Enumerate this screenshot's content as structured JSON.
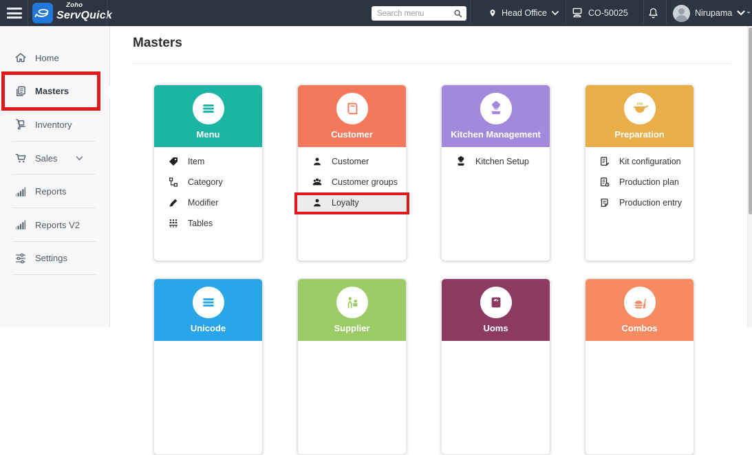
{
  "topbar": {
    "brand": {
      "zoho": "Zoho",
      "product": "ServQuick",
      "logo_color": "#2077d8"
    },
    "search": {
      "placeholder": "Search menu",
      "icon": "search-icon"
    },
    "location": {
      "label": "Head Office",
      "icon": "location-pin-icon"
    },
    "terminal": {
      "label": "CO-50025",
      "icon": "pos-terminal-icon"
    },
    "notifications": {
      "icon": "bell-icon"
    },
    "user": {
      "name": "Nirupama",
      "icon": "avatar"
    },
    "bar_color": "#2c3541"
  },
  "sidebar": {
    "items": [
      {
        "label": "Home",
        "icon": "home-icon"
      },
      {
        "label": "Masters",
        "icon": "masters-icon",
        "active": true,
        "annotated": true
      },
      {
        "label": "Inventory",
        "icon": "inventory-icon"
      },
      {
        "label": "Sales",
        "icon": "sales-cart-icon",
        "expandable": true
      },
      {
        "label": "Reports",
        "icon": "reports-icon"
      },
      {
        "label": "Reports V2",
        "icon": "reports-icon"
      },
      {
        "label": "Settings",
        "icon": "settings-sliders-icon"
      }
    ]
  },
  "main": {
    "title": "Masters",
    "cards": [
      {
        "title": "Menu",
        "color": "#1cb5a3",
        "icon": "menu-lines-icon",
        "items": [
          {
            "label": "Item",
            "icon": "tag-icon"
          },
          {
            "label": "Category",
            "icon": "category-icon"
          },
          {
            "label": "Modifier",
            "icon": "modifier-pen-icon"
          },
          {
            "label": "Tables",
            "icon": "tables-icon"
          }
        ]
      },
      {
        "title": "Customer",
        "color": "#f4795c",
        "icon": "book-icon",
        "items": [
          {
            "label": "Customer",
            "icon": "person-icon"
          },
          {
            "label": "Customer groups",
            "icon": "customer-groups-icon"
          },
          {
            "label": "Loyalty",
            "icon": "person-icon",
            "highlighted": true,
            "annotated": true
          }
        ]
      },
      {
        "title": "Kitchen Management",
        "color": "#a289dc",
        "icon": "chef-icon",
        "items": [
          {
            "label": "Kitchen Setup",
            "icon": "chef-icon"
          }
        ]
      },
      {
        "title": "Preparation",
        "color": "#e9ae47",
        "icon": "cooking-pot-icon",
        "items": [
          {
            "label": "Kit configuration",
            "icon": "kit-configuration-icon"
          },
          {
            "label": "Production plan",
            "icon": "production-plan-icon"
          },
          {
            "label": "Production entry",
            "icon": "production-entry-icon"
          }
        ]
      },
      {
        "title": "Unicode",
        "color": "#2aa6e8",
        "icon": "menu-lines-icon",
        "items": []
      },
      {
        "title": "Supplier",
        "color": "#9cca64",
        "icon": "supplier-icon",
        "items": []
      },
      {
        "title": "Uoms",
        "color": "#8d3a63",
        "icon": "scale-icon",
        "items": []
      },
      {
        "title": "Combos",
        "color": "#f68b62",
        "icon": "combo-food-icon",
        "items": []
      }
    ]
  },
  "annotations": {
    "color": "#df1a1a",
    "targets": [
      "Masters sidebar item",
      "Loyalty card item"
    ]
  }
}
